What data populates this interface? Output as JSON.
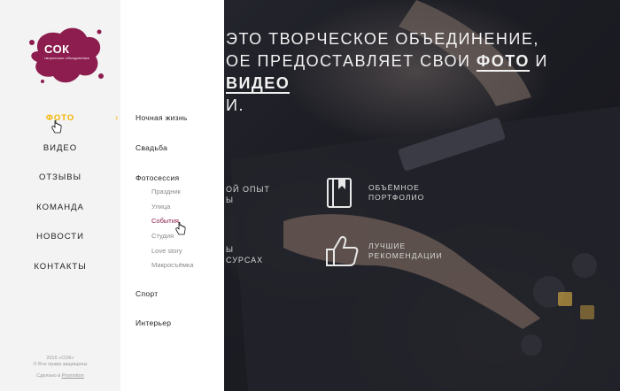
{
  "hero": {
    "title_line1": "это творческое объединение,",
    "title_line2_a": "ое предоставляет свои ",
    "title_word_photo": "ФОТО",
    "title_and": " и ",
    "title_word_video": "ВИДЕО",
    "title_line3": "и.",
    "left_text_1a": "ОЙ ОПЫТ",
    "left_text_1b": "Ы",
    "left_text_2a": "Ы",
    "left_text_2b": "СУРСАХ",
    "features": [
      {
        "icon": "book-icon",
        "text": "Объёмное портфолио"
      },
      {
        "icon": "thumbs-up-icon",
        "text": "Лучшие рекомендации"
      }
    ]
  },
  "logo": {
    "text": "СОК",
    "subtitle": "творческое объединение"
  },
  "nav": {
    "items": [
      {
        "label": "ФОТО",
        "active": true
      },
      {
        "label": "ВИДЕО",
        "active": false
      },
      {
        "label": "ОТЗЫВЫ",
        "active": false
      },
      {
        "label": "КОМАНДА",
        "active": false
      },
      {
        "label": "НОВОСТИ",
        "active": false
      },
      {
        "label": "КОНТАКТЫ",
        "active": false
      }
    ],
    "arrow": "›"
  },
  "submenu": {
    "items": [
      {
        "label": "Ночная жизнь"
      },
      {
        "label": "Свадьба"
      },
      {
        "label": "Фотосессия",
        "children": [
          "Праздник",
          "Улица",
          "События",
          "Студия",
          "Love story",
          "Макросъёмка"
        ],
        "active_child": "События"
      },
      {
        "label": "Спорт"
      },
      {
        "label": "Интерьер"
      }
    ]
  },
  "footer": {
    "line1": "2016 «СОК»",
    "line2": "© Все права защищены",
    "made_prefix": "Сделано в ",
    "made_link": "Promotion"
  },
  "colors": {
    "accent": "#f4b400",
    "brand": "#8c1d4e",
    "sidebar_bg": "#f3f3f3"
  }
}
